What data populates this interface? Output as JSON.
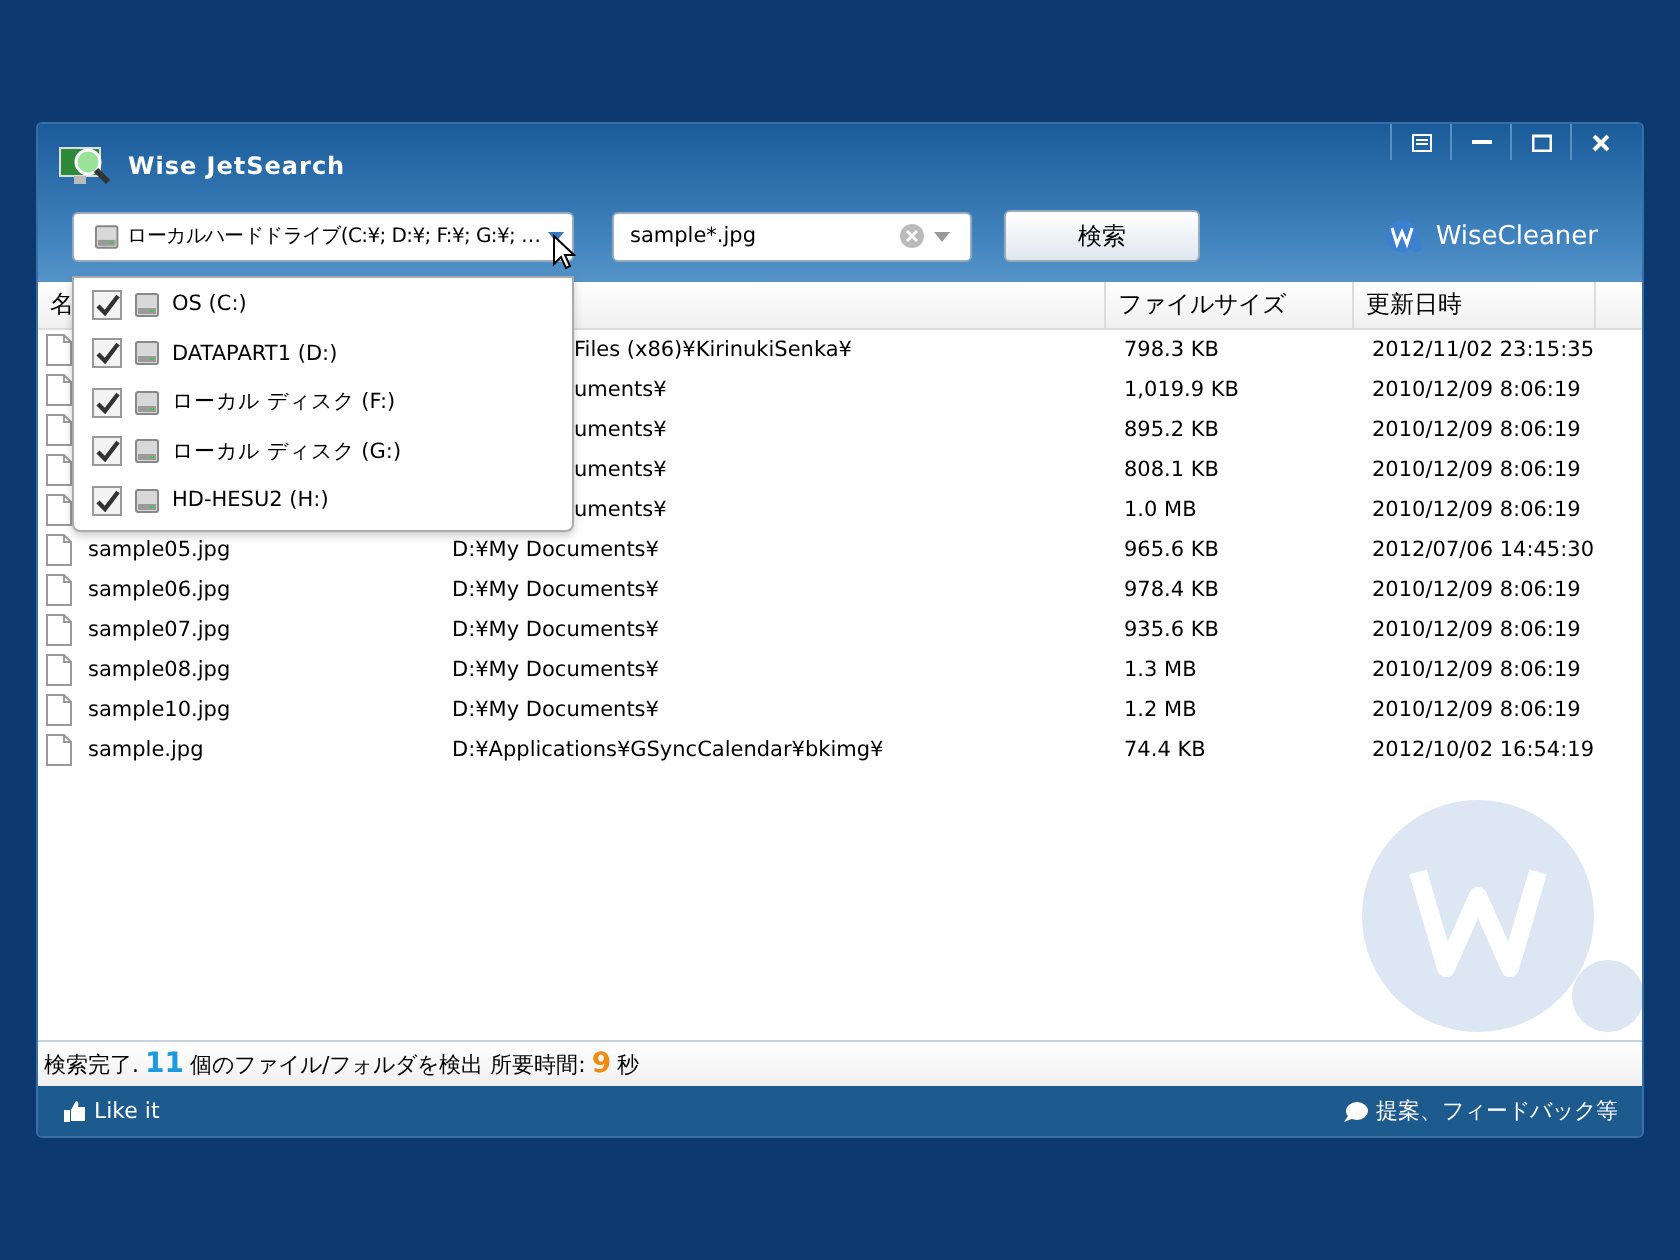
{
  "window": {
    "title": "Wise JetSearch"
  },
  "drive_selector": {
    "value": "ローカルハードドライブ(C:¥; D:¥; F:¥; G:¥; …",
    "expanded": true
  },
  "drives": [
    {
      "label": "OS (C:)",
      "checked": true
    },
    {
      "label": "DATAPART1 (D:)",
      "checked": true
    },
    {
      "label": "ローカル ディスク (F:)",
      "checked": true
    },
    {
      "label": "ローカル ディスク (G:)",
      "checked": true
    },
    {
      "label": "HD-HESU2 (H:)",
      "checked": true
    }
  ],
  "search": {
    "value": "sample*.jpg"
  },
  "search_button": "検索",
  "brand": "WiseCleaner",
  "table": {
    "columns": {
      "column_1": "名",
      "size": "ファイルサイズ",
      "modified": "更新日時"
    },
    "rows": [
      {
        "path": "Files (x86)¥KirinukiSenka¥",
        "size": "798.3 KB",
        "modified": "2012/11/02 23:15:35"
      },
      {
        "path": "uments¥",
        "size": "1,019.9 KB",
        "modified": "2010/12/09 8:06:19"
      },
      {
        "path": "uments¥",
        "size": "895.2 KB",
        "modified": "2010/12/09 8:06:19"
      },
      {
        "path": "uments¥",
        "size": "808.1 KB",
        "modified": "2010/12/09 8:06:19"
      },
      {
        "path": "uments¥",
        "size": "1.0 MB",
        "modified": "2010/12/09 8:06:19"
      },
      {
        "name": "sample05.jpg",
        "path": "D:¥My Documents¥",
        "size": "965.6 KB",
        "modified": "2012/07/06 14:45:30"
      },
      {
        "name": "sample06.jpg",
        "path": "D:¥My Documents¥",
        "size": "978.4 KB",
        "modified": "2010/12/09 8:06:19"
      },
      {
        "name": "sample07.jpg",
        "path": "D:¥My Documents¥",
        "size": "935.6 KB",
        "modified": "2010/12/09 8:06:19"
      },
      {
        "name": "sample08.jpg",
        "path": "D:¥My Documents¥",
        "size": "1.3 MB",
        "modified": "2010/12/09 8:06:19"
      },
      {
        "name": "sample10.jpg",
        "path": "D:¥My Documents¥",
        "size": "1.2 MB",
        "modified": "2010/12/09 8:06:19"
      },
      {
        "name": "sample.jpg",
        "path": "D:¥Applications¥GSyncCalendar¥bkimg¥",
        "size": "74.4 KB",
        "modified": "2012/10/02 16:54:19"
      }
    ]
  },
  "status": {
    "prefix": "検索完了.",
    "count": "11",
    "middle": "個のファイル/フォルダを検出 所要時間:",
    "seconds": "9",
    "suffix": "秒"
  },
  "footer": {
    "like": "Like it",
    "feedback": "提案、フィードバック等"
  }
}
